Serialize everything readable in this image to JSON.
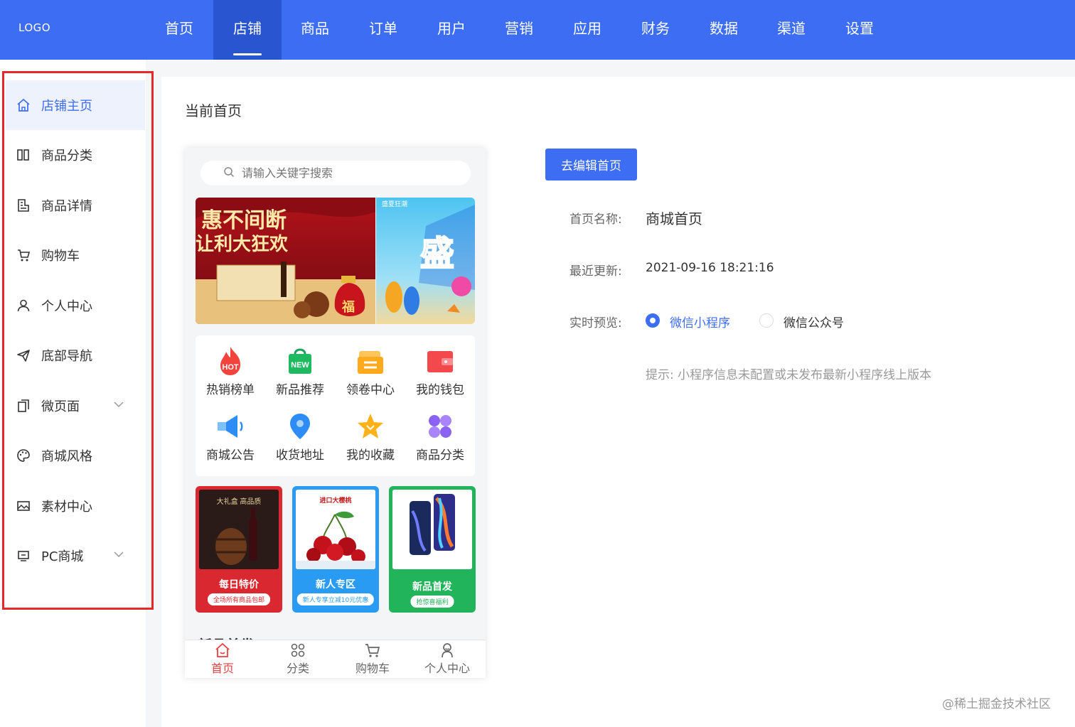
{
  "topnav": {
    "logo": "LOGO",
    "items": [
      "首页",
      "店铺",
      "商品",
      "订单",
      "用户",
      "营销",
      "应用",
      "财务",
      "数据",
      "渠道",
      "设置"
    ],
    "active_index": 1
  },
  "sidebar": {
    "items": [
      {
        "label": "店铺主页",
        "icon": "home-icon"
      },
      {
        "label": "商品分类",
        "icon": "columns-icon"
      },
      {
        "label": "商品详情",
        "icon": "document-icon"
      },
      {
        "label": "购物车",
        "icon": "cart-icon"
      },
      {
        "label": "个人中心",
        "icon": "user-icon"
      },
      {
        "label": "底部导航",
        "icon": "send-icon"
      },
      {
        "label": "微页面",
        "icon": "pages-icon"
      },
      {
        "label": "商城风格",
        "icon": "palette-icon"
      },
      {
        "label": "素材中心",
        "icon": "image-icon"
      },
      {
        "label": "PC商城",
        "icon": "monitor-icon"
      }
    ]
  },
  "main": {
    "title": "当前首页"
  },
  "phone": {
    "search_placeholder": "请输入关键字搜索",
    "banner1_text": "惠不间断 让利大狂欢",
    "banner1_badge": "福",
    "banner2_text": "盛",
    "banner2_sub": "盛夏狂潮",
    "grid": [
      {
        "label": "热销榜单",
        "badge": "HOT"
      },
      {
        "label": "新品推荐",
        "badge": "NEW"
      },
      {
        "label": "领卷中心"
      },
      {
        "label": "我的钱包"
      },
      {
        "label": "商城公告"
      },
      {
        "label": "收货地址"
      },
      {
        "label": "我的收藏"
      },
      {
        "label": "商品分类"
      }
    ],
    "cards": [
      {
        "title": "每日特价",
        "sub": "全场所有商品包邮",
        "img_caption": "大礼盒 高品质",
        "color": "#d9282f"
      },
      {
        "title": "新人专区",
        "sub": "新人专享立减10元优惠",
        "img_caption": "进口大樱桃",
        "color": "#2a9bf2"
      },
      {
        "title": "新品首发",
        "sub": "抢惊喜福利",
        "color": "#22b45a"
      }
    ],
    "section_title": "新品首发",
    "tabs": [
      "首页",
      "分类",
      "购物车",
      "个人中心"
    ]
  },
  "info": {
    "edit_button": "去编辑首页",
    "name_label": "首页名称:",
    "name_value": "商城首页",
    "update_label": "最近更新:",
    "update_value": "2021-09-16 18:21:16",
    "preview_label": "实时预览:",
    "preview_options": [
      "微信小程序",
      "微信公众号"
    ],
    "hint": "提示: 小程序信息未配置或未发布最新小程序线上版本"
  },
  "watermark": "@稀土掘金技术社区",
  "colors": {
    "primary": "#3d6df2",
    "highlight_border": "#e5282a",
    "active_tab": "#e84142"
  }
}
